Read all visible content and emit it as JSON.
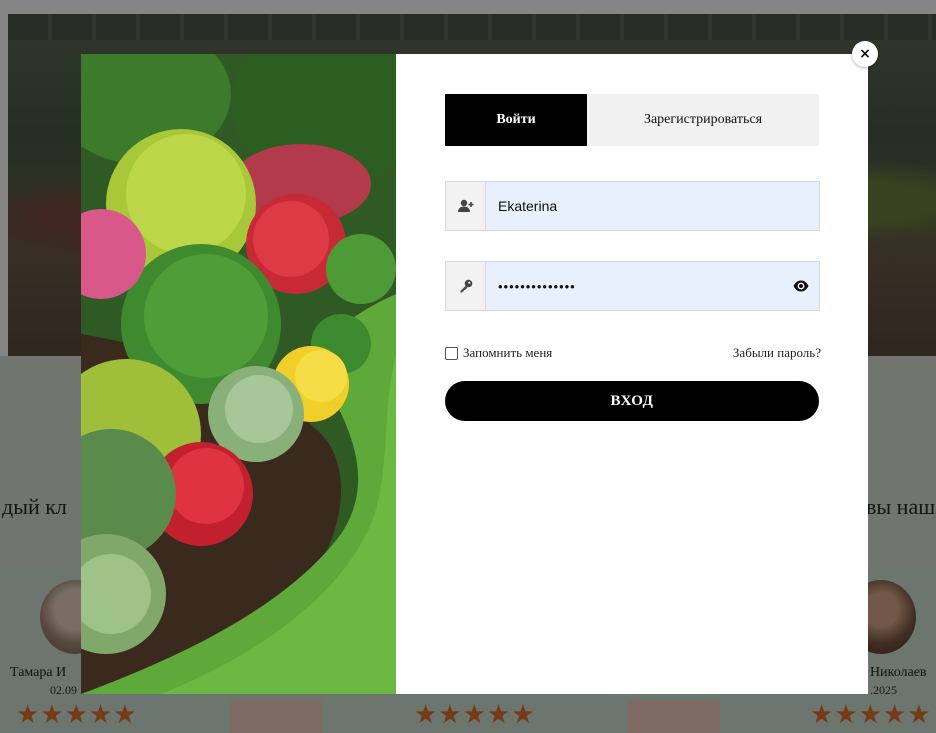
{
  "background": {
    "text_left": "дый кл",
    "text_right": "вы наш",
    "review_left": {
      "name": "Тамара И",
      "date": "02.09"
    },
    "review_right": {
      "name": "Николаев",
      "date": ".2025"
    },
    "stars": "★★★★★"
  },
  "modal": {
    "close_label": "×",
    "tabs": [
      {
        "label": "Войти",
        "active": true
      },
      {
        "label": "Зарегистрироваться",
        "active": false
      }
    ],
    "username": {
      "value": "Ekaterina",
      "icon": "user-plus-icon"
    },
    "password": {
      "value": "••••••••••••••",
      "icon": "key-icon",
      "toggle_icon": "eye-icon"
    },
    "remember_label": "Запомнить меня",
    "remember_checked": false,
    "forgot_label": "Забыли пароль?",
    "submit_label": "ВХОД"
  },
  "colors": {
    "accent": "#000000",
    "autofill": "#e8f0fe",
    "inactive_tab": "#f1f1f1",
    "stars": "#e06f2e"
  }
}
